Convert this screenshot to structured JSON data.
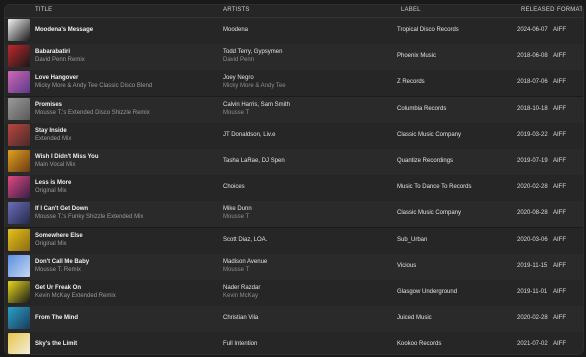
{
  "columns": {
    "title": "TITLE",
    "artists": "ARTISTS",
    "label": "LABEL",
    "released": "RELEASED",
    "format": "FORMAT"
  },
  "tracks": [
    {
      "title": "Moodena's Message",
      "mix": "",
      "artists": "Moodena",
      "remixer": "",
      "label": "Tropical Disco Records",
      "released": "2024-06-07",
      "format": "AIFF",
      "art_colors": [
        "#f2f2f2",
        "#1b1b1b"
      ]
    },
    {
      "title": "Babarabatiri",
      "mix": "David Penn Remix",
      "artists": "Todd Terry, Gypsymen",
      "remixer": "David Penn",
      "label": "Phoenix Music",
      "released": "2018-06-08",
      "format": "AIFF",
      "art_colors": [
        "#c0282c",
        "#181818"
      ]
    },
    {
      "title": "Love Hangover",
      "mix": "Micky More & Andy Tee Classic Disco Blend",
      "artists": "Joey Negro",
      "remixer": "Micky More & Andy Tee",
      "label": "Z Records",
      "released": "2018-07-06",
      "format": "AIFF",
      "art_colors": [
        "#d068b4",
        "#5a3a8a"
      ]
    },
    {
      "title": "Promises",
      "mix": "Mousse T.'s Extended Disco Shizzle Remix",
      "artists": "Calvin Harris, Sam Smith",
      "remixer": "Mousse T",
      "label": "Columbia Records",
      "released": "2018-10-18",
      "format": "AIFF",
      "art_colors": [
        "#9a9a9a",
        "#5a5a5a"
      ]
    },
    {
      "title": "Stay Inside",
      "mix": "Extended Mix",
      "artists": "JT Donaldson, Liv.e",
      "remixer": "",
      "label": "Classic Music Company",
      "released": "2019-03-22",
      "format": "AIFF",
      "art_colors": [
        "#b8473f",
        "#4a2a2a"
      ]
    },
    {
      "title": "Wish I Didn't Miss You",
      "mix": "Main Vocal Mix",
      "artists": "Tasha LaRae, DJ Spen",
      "remixer": "",
      "label": "Quantize Recordings",
      "released": "2019-07-19",
      "format": "AIFF",
      "art_colors": [
        "#e0a21e",
        "#6b3a16"
      ]
    },
    {
      "title": "Less is More",
      "mix": "Original Mix",
      "artists": "Choices",
      "remixer": "",
      "label": "Music To Dance To Records",
      "released": "2020-02-28",
      "format": "AIFF",
      "art_colors": [
        "#e04a80",
        "#3a1e48"
      ]
    },
    {
      "title": "If I Can't Get Down",
      "mix": "Mousse T.'s Funky Shizzle Extended Mix",
      "artists": "Mike Dunn",
      "remixer": "Mousse T",
      "label": "Classic Music Company",
      "released": "2020-08-28",
      "format": "AIFF",
      "art_colors": [
        "#6a6fb8",
        "#26284a"
      ]
    },
    {
      "title": "Somewhere Else",
      "mix": "Original Mix",
      "artists": "Scott Diaz, LOA.",
      "remixer": "",
      "label": "Sub_Urban",
      "released": "2020-03-06",
      "format": "AIFF",
      "art_colors": [
        "#e6c21a",
        "#8a6a14"
      ]
    },
    {
      "title": "Don't Call Me Baby",
      "mix": "Mousse T. Remix",
      "artists": "Madison Avenue",
      "remixer": "Mousse T",
      "label": "Vicious",
      "released": "2019-11-15",
      "format": "AIFF",
      "art_colors": [
        "#5a8fe0",
        "#c8d8f0"
      ]
    },
    {
      "title": "Get Ur Freak On",
      "mix": "Kevin McKay Extended Remix",
      "artists": "Nader Razdar",
      "remixer": "Kevin McKay",
      "label": "Glasgow Underground",
      "released": "2019-11-01",
      "format": "AIFF",
      "art_colors": [
        "#e6d81e",
        "#1a1a1a"
      ]
    },
    {
      "title": "From The Mind",
      "mix": "",
      "artists": "Christian Vila",
      "remixer": "",
      "label": "Juiced Music",
      "released": "2020-02-28",
      "format": "AIFF",
      "art_colors": [
        "#2aa0c8",
        "#1c3a5a"
      ]
    },
    {
      "title": "Sky's the Limit",
      "mix": "",
      "artists": "Full Intention",
      "remixer": "",
      "label": "Kookoo Records",
      "released": "2021-07-02",
      "format": "AIFF",
      "art_colors": [
        "#e8c44a",
        "#f2efe0"
      ]
    }
  ]
}
